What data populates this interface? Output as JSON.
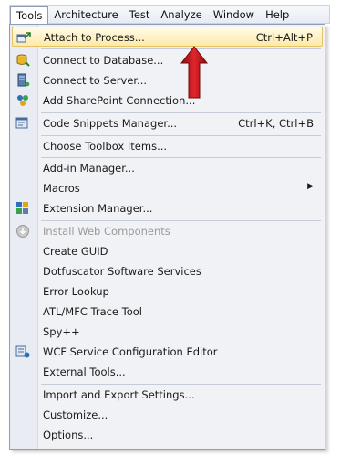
{
  "menubar": {
    "items": [
      {
        "label": "Tools"
      },
      {
        "label": "Architecture"
      },
      {
        "label": "Test"
      },
      {
        "label": "Analyze"
      },
      {
        "label": "Window"
      },
      {
        "label": "Help"
      }
    ]
  },
  "menu": {
    "items": [
      {
        "label": "Attach to Process...",
        "shortcut": "Ctrl+Alt+P",
        "icon": "attach-process-icon"
      },
      {
        "label": "Connect to Database...",
        "icon": "database-icon"
      },
      {
        "label": "Connect to Server...",
        "icon": "server-icon"
      },
      {
        "label": "Add SharePoint Connection...",
        "icon": "sharepoint-icon"
      },
      {
        "label": "Code Snippets Manager...",
        "shortcut": "Ctrl+K, Ctrl+B",
        "icon": "snippets-icon"
      },
      {
        "label": "Choose Toolbox Items..."
      },
      {
        "label": "Add-in Manager..."
      },
      {
        "label": "Macros"
      },
      {
        "label": "Extension Manager...",
        "icon": "extension-icon"
      },
      {
        "label": "Install Web Components",
        "icon": "install-icon"
      },
      {
        "label": "Create GUID"
      },
      {
        "label": "Dotfuscator Software Services"
      },
      {
        "label": "Error Lookup"
      },
      {
        "label": "ATL/MFC Trace Tool"
      },
      {
        "label": "Spy++"
      },
      {
        "label": "WCF Service Configuration Editor",
        "icon": "wcf-config-icon"
      },
      {
        "label": "External Tools..."
      },
      {
        "label": "Import and Export Settings..."
      },
      {
        "label": "Customize..."
      },
      {
        "label": "Options..."
      }
    ]
  },
  "colors": {
    "highlight": "#fdeaa8",
    "annotation_arrow": "#c0161b"
  }
}
